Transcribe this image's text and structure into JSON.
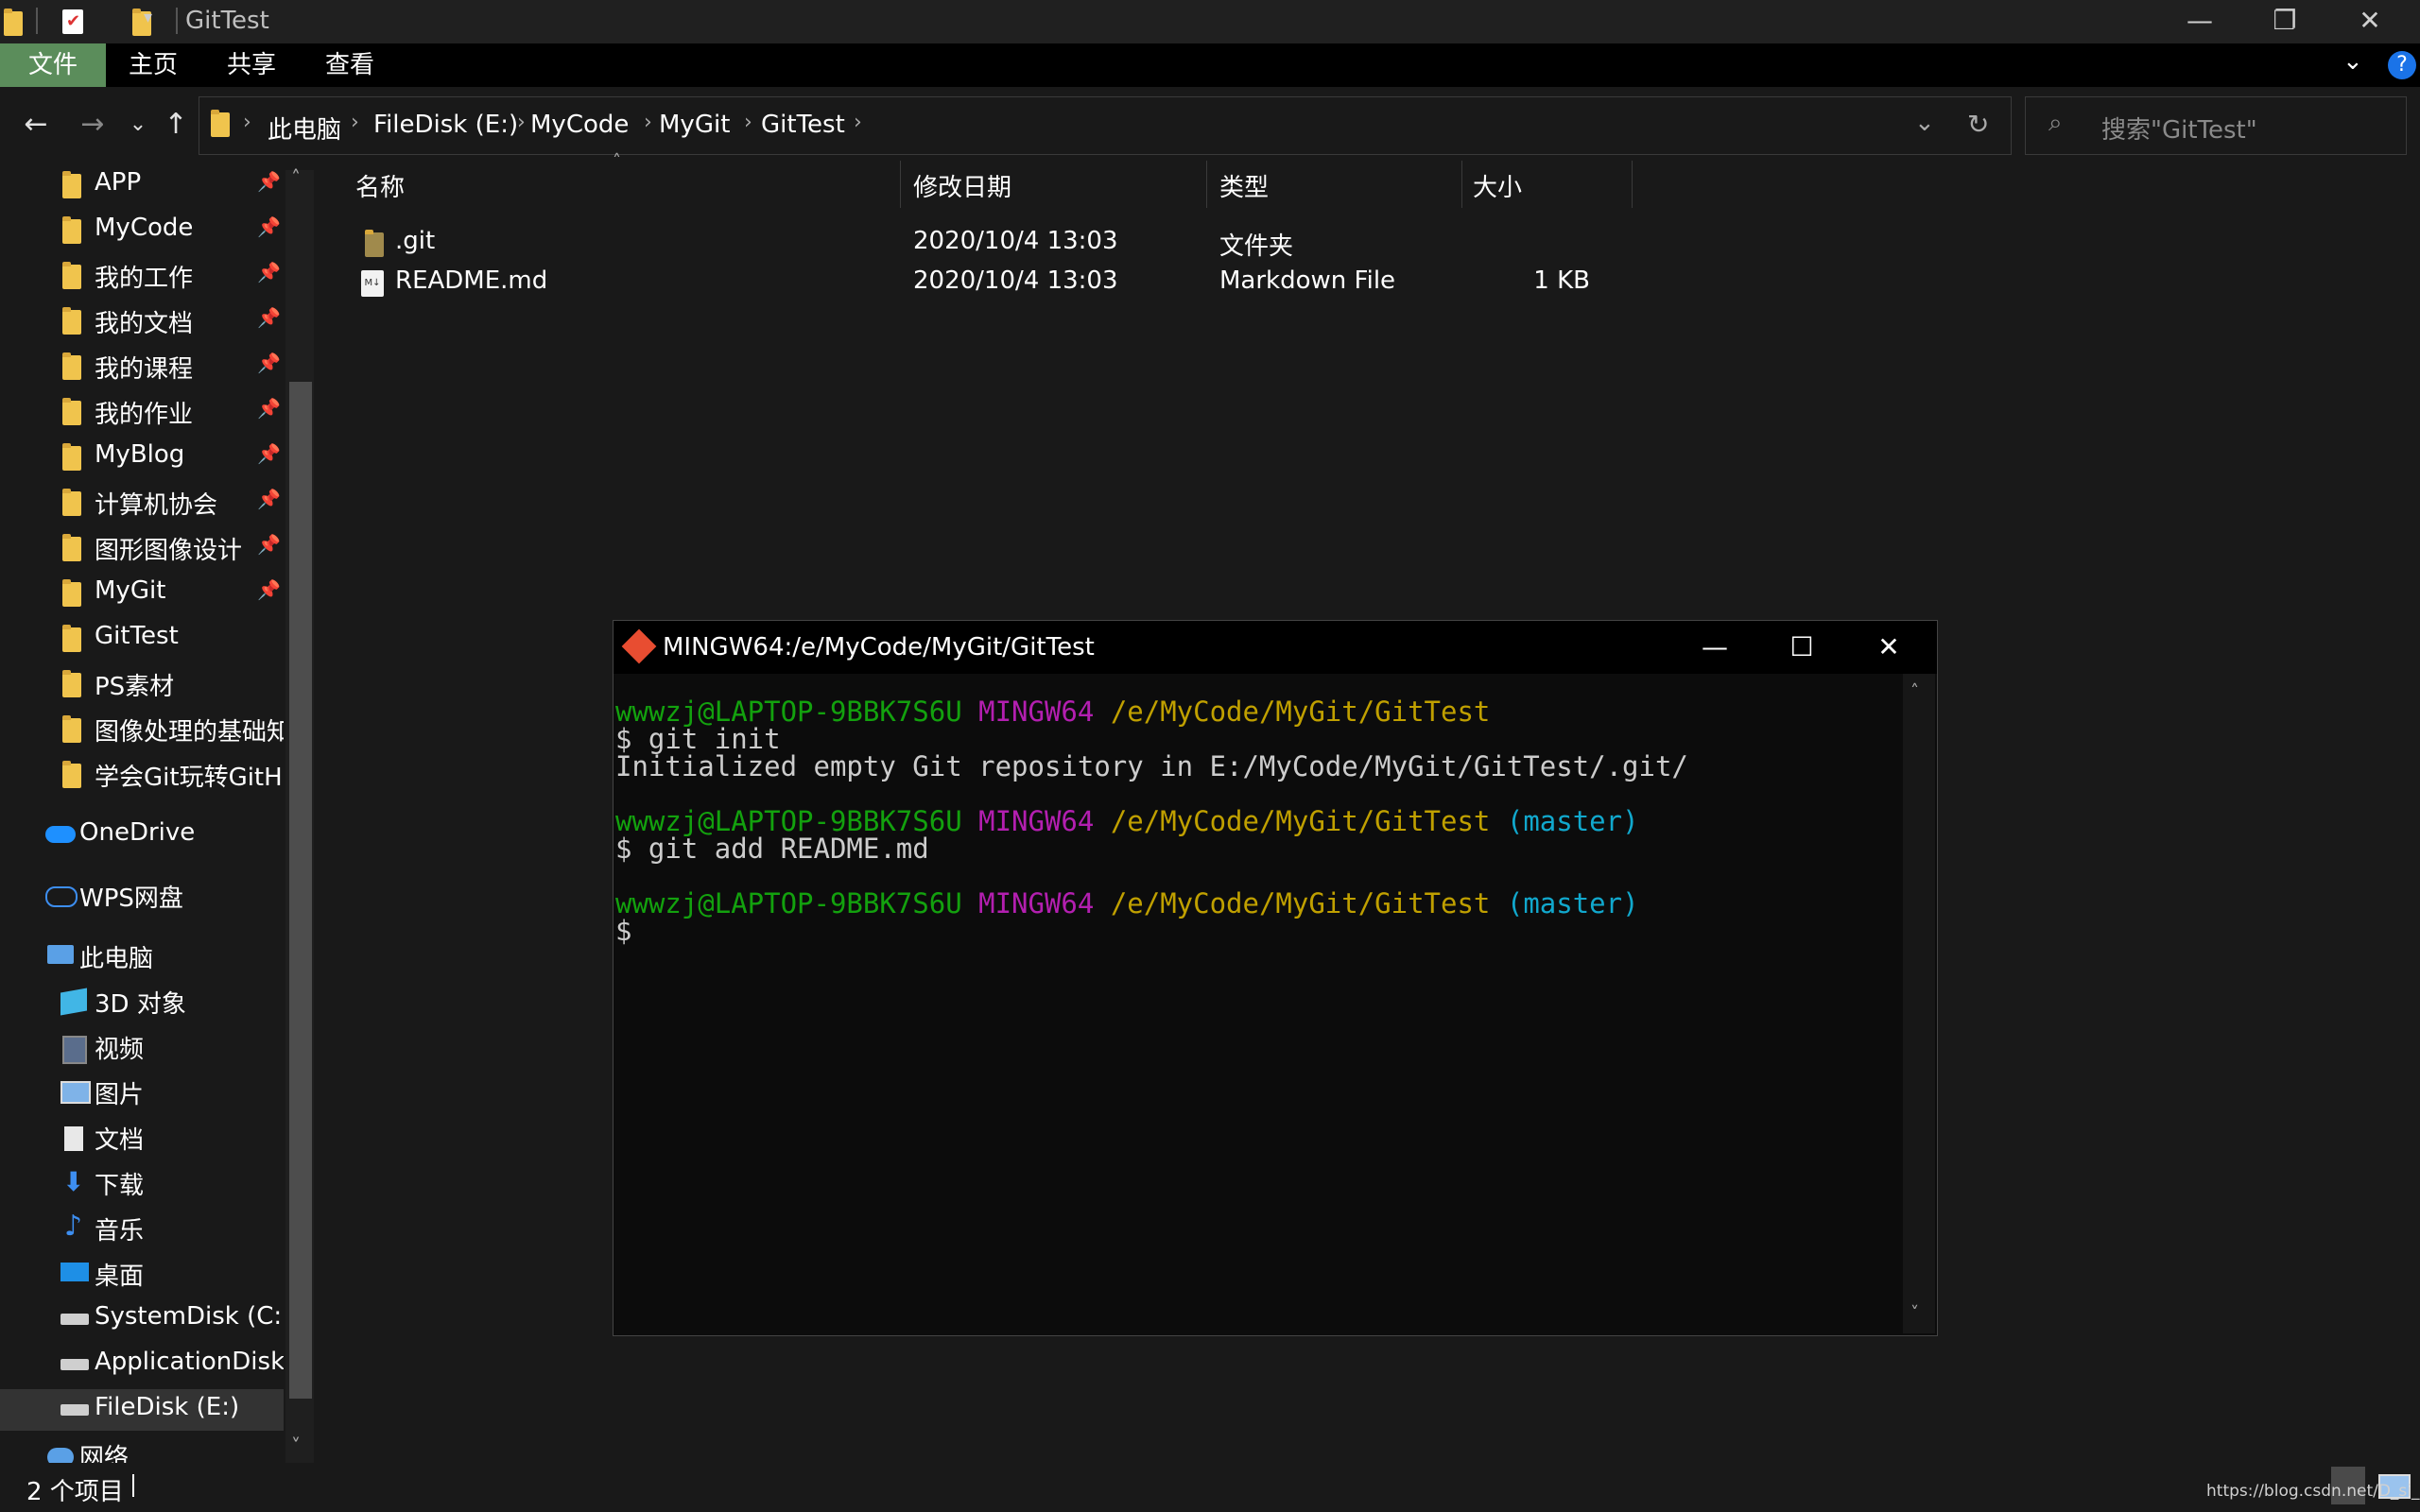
{
  "window": {
    "title": "GitTest",
    "min_glyph": "—",
    "restore_glyph": "❐",
    "close_glyph": "✕"
  },
  "ribbon": {
    "tabs": [
      {
        "label": "文件"
      },
      {
        "label": "主页"
      },
      {
        "label": "共享"
      },
      {
        "label": "查看"
      }
    ],
    "help_glyph": "?"
  },
  "address": {
    "crumbs": [
      "此电脑",
      "FileDisk (E:)",
      "MyCode",
      "MyGit",
      "GitTest"
    ],
    "search_placeholder": "搜索\"GitTest\""
  },
  "sidebar": {
    "quick_access": [
      {
        "label": "APP",
        "pinned": true
      },
      {
        "label": "MyCode",
        "pinned": true
      },
      {
        "label": "我的工作",
        "pinned": true
      },
      {
        "label": "我的文档",
        "pinned": true
      },
      {
        "label": "我的课程",
        "pinned": true
      },
      {
        "label": "我的作业",
        "pinned": true
      },
      {
        "label": "MyBlog",
        "pinned": true
      },
      {
        "label": "计算机协会",
        "pinned": true
      },
      {
        "label": "图形图像设计",
        "pinned": true
      },
      {
        "label": "MyGit",
        "pinned": true
      },
      {
        "label": "GitTest",
        "pinned": false
      },
      {
        "label": "PS素材",
        "pinned": false
      },
      {
        "label": "图像处理的基础知识",
        "pinned": false
      },
      {
        "label": "学会Git玩转GitHub",
        "pinned": false
      }
    ],
    "onedrive": "OneDrive",
    "wps": "WPS网盘",
    "this_pc": "此电脑",
    "pc_items": [
      {
        "label": "3D 对象",
        "icon": "cube-icon"
      },
      {
        "label": "视频",
        "icon": "video-icon"
      },
      {
        "label": "图片",
        "icon": "picture-icon"
      },
      {
        "label": "文档",
        "icon": "document-icon"
      },
      {
        "label": "下载",
        "icon": "download-icon"
      },
      {
        "label": "音乐",
        "icon": "music-icon"
      },
      {
        "label": "桌面",
        "icon": "desktop-icon"
      },
      {
        "label": "SystemDisk (C:)",
        "icon": "drive-icon"
      },
      {
        "label": "ApplicationDisk (D:)",
        "icon": "drive-icon"
      },
      {
        "label": "FileDisk (E:)",
        "icon": "drive-icon"
      }
    ],
    "network": "网络"
  },
  "columns": {
    "name": "名称",
    "modified": "修改日期",
    "type": "类型",
    "size": "大小"
  },
  "files": [
    {
      "name": ".git",
      "modified": "2020/10/4 13:03",
      "type": "文件夹",
      "size": ""
    },
    {
      "name": "README.md",
      "modified": "2020/10/4 13:03",
      "type": "Markdown File",
      "size": "1 KB"
    }
  ],
  "status": {
    "count": "2 个项目",
    "watermark": "https://blog.csdn.net/D_si_..."
  },
  "terminal": {
    "title": "MINGW64:/e/MyCode/MyGit/GitTest",
    "user_host": "wwwzj@LAPTOP-9BBK7S6U",
    "env": "MINGW64",
    "path": "/e/MyCode/MyGit/GitTest",
    "branch": "(master)",
    "cmd1": "$ git init",
    "out1": "Initialized empty Git repository in E:/MyCode/MyGit/GitTest/.git/",
    "cmd2": "$ git add README.md",
    "prompt": "$"
  },
  "colors": {
    "prompt_user": "#13a10e",
    "prompt_env": "#b31fb0",
    "prompt_path": "#c0a000",
    "prompt_branch": "#11a8cd",
    "file_tab": "#5b8d5b",
    "folder": "#f0c44d"
  }
}
